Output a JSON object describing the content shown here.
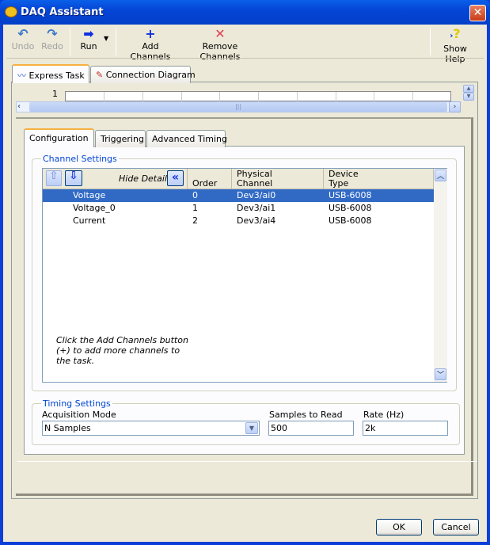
{
  "window": {
    "title": "DAQ Assistant",
    "close_icon": "close-icon"
  },
  "toolbar": {
    "undo": "Undo",
    "redo": "Redo",
    "run": "Run",
    "add_channels": "Add Channels",
    "remove_channels": "Remove Channels",
    "show_help": "Show Help"
  },
  "tabs": [
    {
      "label": "Express Task",
      "active": true
    },
    {
      "label": "Connection Diagram",
      "active": false
    }
  ],
  "graph": {
    "y_tick": "1"
  },
  "sub_tabs": [
    {
      "label": "Configuration",
      "active": true
    },
    {
      "label": "Triggering"
    },
    {
      "label": "Advanced Timing"
    }
  ],
  "channel_settings": {
    "label": "Channel Settings",
    "hide_details": "Hide Details",
    "columns": [
      "Order",
      "Physical\nChannel",
      "Device\nType"
    ],
    "columns_display": {
      "order": "Order",
      "physical_1": "Physical",
      "physical_2": "Channel",
      "device_1": "Device",
      "device_2": "Type"
    },
    "rows": [
      {
        "name": "Voltage",
        "order": "0",
        "channel": "Dev3/ai0",
        "device": "USB-6008",
        "selected": true
      },
      {
        "name": "Voltage_0",
        "order": "1",
        "channel": "Dev3/ai1",
        "device": "USB-6008"
      },
      {
        "name": "Current",
        "order": "2",
        "channel": "Dev3/ai4",
        "device": "USB-6008"
      }
    ],
    "hint": [
      "Click the Add Channels button",
      "(+) to add more channels to",
      "the task."
    ],
    "selection_color": "#316AC5"
  },
  "timing_settings": {
    "label": "Timing Settings",
    "acquisition_mode_label": "Acquisition Mode",
    "acquisition_mode": "N Samples",
    "samples_label": "Samples to Read",
    "samples": "500",
    "rate_label": "Rate (Hz)",
    "rate": "2k"
  },
  "footer": {
    "ok": "OK",
    "cancel": "Cancel"
  }
}
